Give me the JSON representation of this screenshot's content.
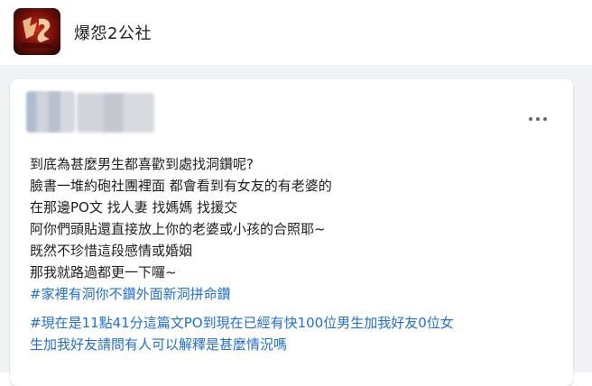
{
  "group": {
    "name": "爆怨2公社",
    "logo_text": "爆怨2公社"
  },
  "post": {
    "lines": [
      "到底為甚麼男生都喜歡到處找洞鑽呢?",
      "臉書一堆約砲社團裡面 都會看到有女友的有老婆的",
      "在那邊PO文 找人妻 找媽媽 找援交",
      "阿你們頭貼還直接放上你的老婆或小孩的合照耶~",
      "既然不珍惜這段感情或婚姻",
      "那我就路過都更一下囉~"
    ],
    "hashtag_1": "#家裡有洞你不鑽外面新洞拼命鑽",
    "hashtag_2_line1": "#現在是11點41分這篇文PO到現在已經有快100位男生加我好友0位女",
    "hashtag_2_line2": "生加我好友請問有人可以解釋是甚麼情況嗎"
  },
  "icons": {
    "more": "more-horizontal-icon"
  },
  "colors": {
    "link": "#216fdb",
    "text": "#1c1e21",
    "feed_bg": "#f0f2f5"
  }
}
